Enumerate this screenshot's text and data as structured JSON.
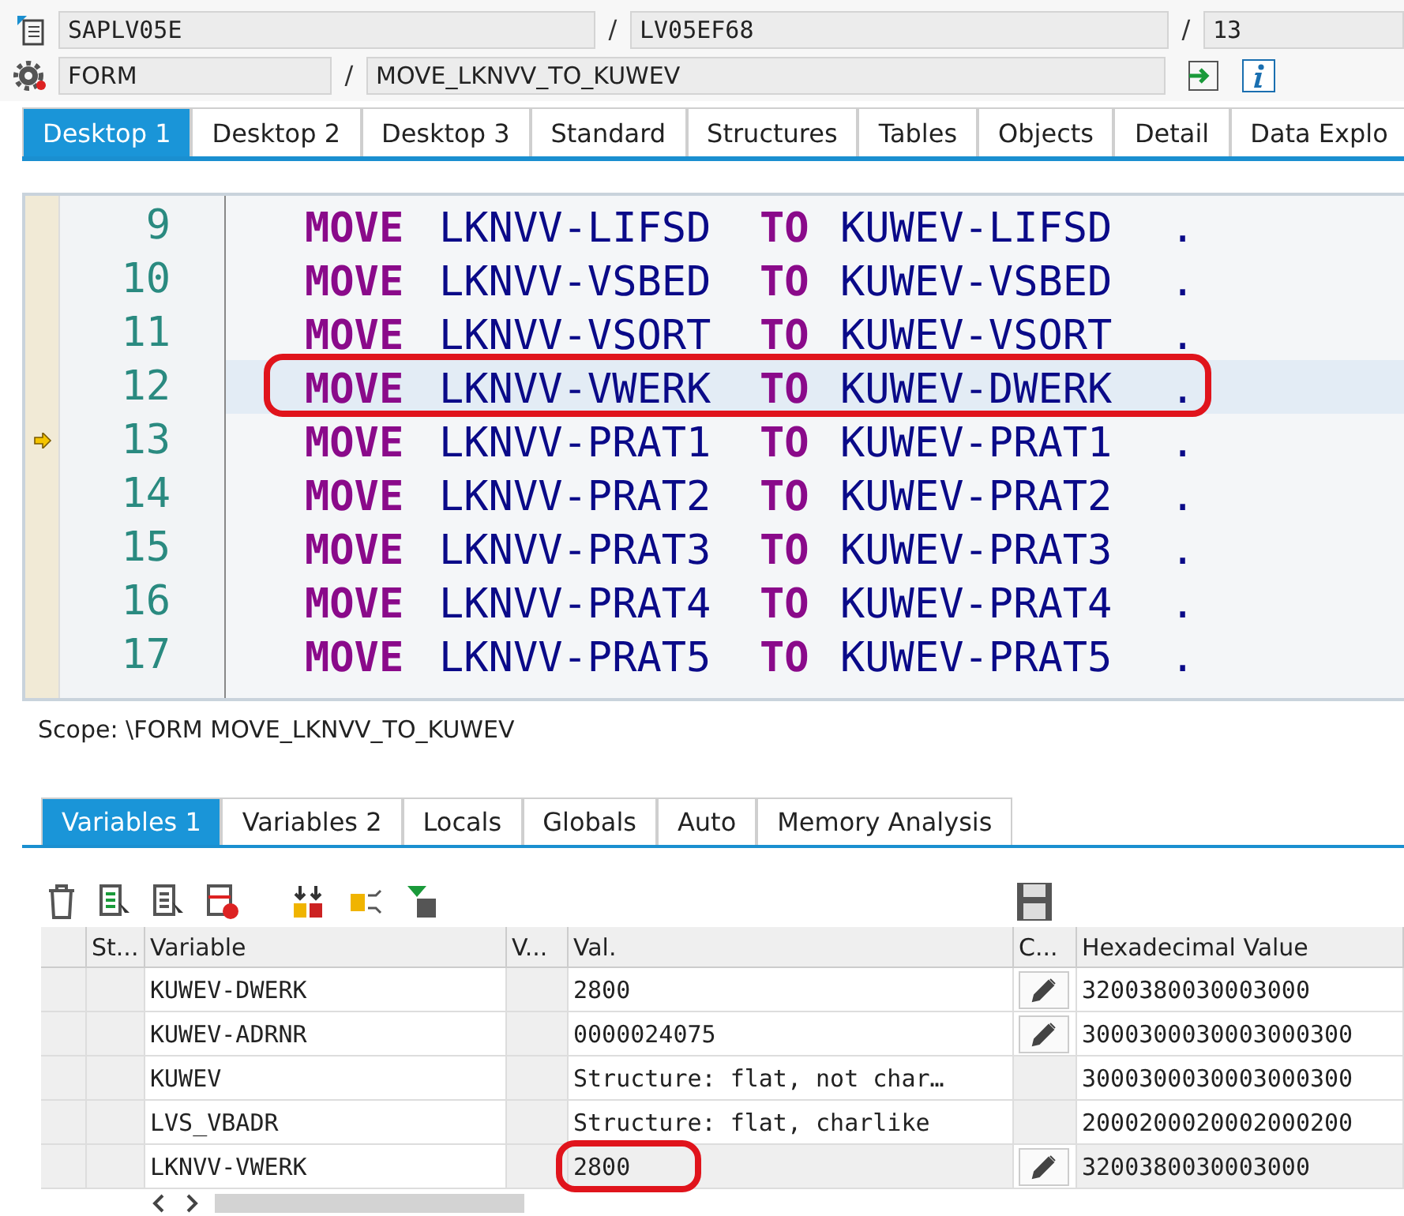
{
  "header": {
    "program": "SAPLV05E",
    "include": "LV05EF68",
    "line": "13",
    "event_type": "FORM",
    "event_name": "MOVE_LKNVV_TO_KUWEV",
    "separators": [
      "/",
      "/",
      "/"
    ]
  },
  "desktop_tabs": [
    {
      "label": "Desktop 1",
      "selected": true
    },
    {
      "label": "Desktop 2",
      "selected": false
    },
    {
      "label": "Desktop 3",
      "selected": false
    },
    {
      "label": "Standard",
      "selected": false
    },
    {
      "label": "Structures",
      "selected": false
    },
    {
      "label": "Tables",
      "selected": false
    },
    {
      "label": "Objects",
      "selected": false
    },
    {
      "label": "Detail",
      "selected": false
    },
    {
      "label": "Data Explo",
      "selected": false
    }
  ],
  "code_lines": [
    {
      "number": "9",
      "keyword": "MOVE",
      "source": "LKNVV-LIFSD",
      "to": "TO",
      "target": "KUWEV-LIFSD",
      "end": ".",
      "current": false,
      "pointer": false,
      "annotated": false
    },
    {
      "number": "10",
      "keyword": "MOVE",
      "source": "LKNVV-VSBED",
      "to": "TO",
      "target": "KUWEV-VSBED",
      "end": ".",
      "current": false,
      "pointer": false,
      "annotated": false
    },
    {
      "number": "11",
      "keyword": "MOVE",
      "source": "LKNVV-VSORT",
      "to": "TO",
      "target": "KUWEV-VSORT",
      "end": ".",
      "current": false,
      "pointer": false,
      "annotated": false
    },
    {
      "number": "12",
      "keyword": "MOVE",
      "source": "LKNVV-VWERK",
      "to": "TO",
      "target": "KUWEV-DWERK",
      "end": ".",
      "current": true,
      "pointer": false,
      "annotated": true
    },
    {
      "number": "13",
      "keyword": "MOVE",
      "source": "LKNVV-PRAT1",
      "to": "TO",
      "target": "KUWEV-PRAT1",
      "end": ".",
      "current": false,
      "pointer": true,
      "annotated": false
    },
    {
      "number": "14",
      "keyword": "MOVE",
      "source": "LKNVV-PRAT2",
      "to": "TO",
      "target": "KUWEV-PRAT2",
      "end": ".",
      "current": false,
      "pointer": false,
      "annotated": false
    },
    {
      "number": "15",
      "keyword": "MOVE",
      "source": "LKNVV-PRAT3",
      "to": "TO",
      "target": "KUWEV-PRAT3",
      "end": ".",
      "current": false,
      "pointer": false,
      "annotated": false
    },
    {
      "number": "16",
      "keyword": "MOVE",
      "source": "LKNVV-PRAT4",
      "to": "TO",
      "target": "KUWEV-PRAT4",
      "end": ".",
      "current": false,
      "pointer": false,
      "annotated": false
    },
    {
      "number": "17",
      "keyword": "MOVE",
      "source": "LKNVV-PRAT5",
      "to": "TO",
      "target": "KUWEV-PRAT5",
      "end": ".",
      "current": false,
      "pointer": false,
      "annotated": false
    }
  ],
  "scope": "Scope: \\FORM MOVE_LKNVV_TO_KUWEV",
  "variable_tabs": [
    {
      "label": "Variables 1",
      "selected": true
    },
    {
      "label": "Variables 2",
      "selected": false
    },
    {
      "label": "Locals",
      "selected": false
    },
    {
      "label": "Globals",
      "selected": false
    },
    {
      "label": "Auto",
      "selected": false
    },
    {
      "label": "Memory Analysis",
      "selected": false
    }
  ],
  "table": {
    "columns": [
      "St...",
      "Variable",
      "V...",
      "Val.",
      "C...",
      "Hexadecimal Value"
    ],
    "rows": [
      {
        "variable": "KUWEV-DWERK",
        "value": "2800",
        "editable": true,
        "hex": "3200380030003000",
        "annotated": false
      },
      {
        "variable": "KUWEV-ADRNR",
        "value": "0000024075",
        "editable": true,
        "hex": "3000300030003000300",
        "annotated": false
      },
      {
        "variable": "KUWEV",
        "value": "Structure: flat, not char…",
        "editable": false,
        "hex": "3000300030003000300",
        "annotated": false
      },
      {
        "variable": "LVS_VBADR",
        "value": "Structure: flat, charlike",
        "editable": false,
        "hex": "2000200020002000200",
        "annotated": false
      },
      {
        "variable": "LKNVV-VWERK",
        "value": "2800",
        "editable": true,
        "hex": "3200380030003000",
        "annotated": true
      }
    ]
  }
}
